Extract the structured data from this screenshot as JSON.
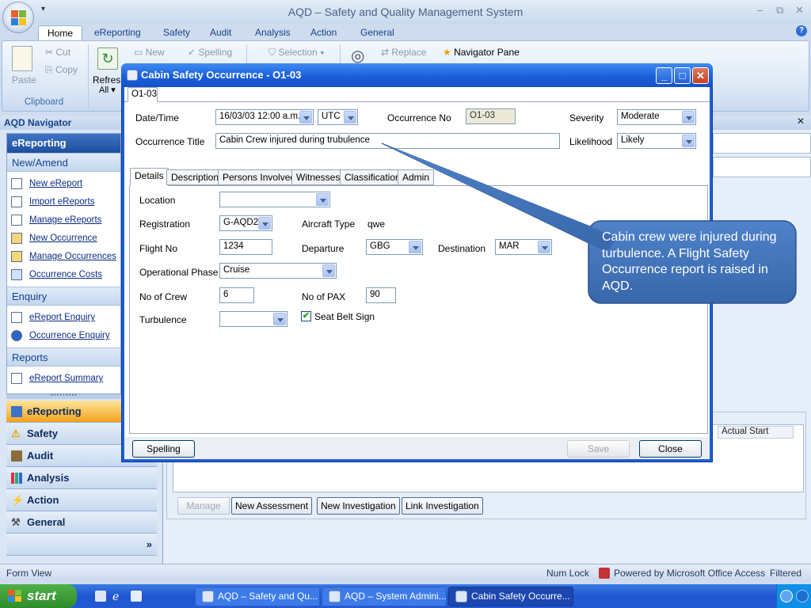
{
  "app": {
    "title": "AQD – Safety and Quality Management System",
    "minimize": "–",
    "restore": "⧉",
    "close": "✕",
    "help": "?",
    "qat_arrow": "▾"
  },
  "ribbon": {
    "tabs": [
      "Home",
      "eReporting",
      "Safety",
      "Audit",
      "Analysis",
      "Action",
      "General"
    ],
    "active_tab": "Home",
    "paste": "Paste",
    "cut": "Cut",
    "copy": "Copy",
    "clipboard_group": "Clipboard",
    "refresh": "Refresh",
    "refresh_all": "All ▾",
    "new": "New",
    "spelling": "Spelling",
    "selection": "Selection ▾",
    "replace": "Replace",
    "navigator_pane": "Navigator Pane"
  },
  "navigator": {
    "header": "AQD Navigator",
    "title": "eReporting",
    "section_new": "New/Amend",
    "items_new": [
      "New eReport",
      "Import eReports",
      "Manage eReports",
      "New Occurrence",
      "Manage Occurrences",
      "Occurrence Costs"
    ],
    "section_enquiry": "Enquiry",
    "items_enquiry": [
      "eReport Enquiry",
      "Occurrence Enquiry"
    ],
    "section_reports": "Reports",
    "items_reports": [
      "eReport Summary"
    ],
    "modules": [
      "eReporting",
      "Safety",
      "Audit",
      "Analysis",
      "Action",
      "General"
    ],
    "active_module": "eReporting",
    "more": "»"
  },
  "background": {
    "grid_column": "Actual Start",
    "close_x": "✕",
    "buttons": [
      "Manage",
      "New Assessment",
      "New Investigation",
      "Link Investigation"
    ]
  },
  "status_bar": {
    "left": "Form View",
    "num_lock": "Num Lock",
    "powered_by": "Powered by Microsoft Office Access",
    "filtered": "Filtered"
  },
  "taskbar": {
    "start": "start",
    "tasks": [
      "AQD – Safety and Qu...",
      "AQD – System Admini...",
      "Cabin Safety Occurre..."
    ],
    "active_task": 2
  },
  "dialog": {
    "title": "Cabin Safety Occurrence - O1-03",
    "tab": "O1-03",
    "date_time_label": "Date/Time",
    "date_time_value": "16/03/03 12:00 a.m.",
    "timezone_value": "UTC",
    "occurrence_no_label": "Occurrence No",
    "occurrence_no_value": "O1-03",
    "severity_label": "Severity",
    "severity_value": "Moderate",
    "occurrence_title_label": "Occurrence Title",
    "occurrence_title_value": "Cabin Crew injured during trubulence",
    "likelihood_label": "Likelihood",
    "likelihood_value": "Likely",
    "subtabs": [
      "Details",
      "Description",
      "Persons Involved",
      "Witnesses",
      "Classification",
      "Admin"
    ],
    "active_subtab": "Details",
    "details": {
      "location_label": "Location",
      "location_value": "",
      "registration_label": "Registration",
      "registration_value": "G-AQD2",
      "aircraft_type_label": "Aircraft Type",
      "aircraft_type_value": "qwe",
      "flight_no_label": "Flight No",
      "flight_no_value": "1234",
      "departure_label": "Departure",
      "departure_value": "GBG",
      "destination_label": "Destination",
      "destination_value": "MAR",
      "operational_phase_label": "Operational Phase",
      "operational_phase_value": "Cruise",
      "crew_label": "No of Crew",
      "crew_value": "6",
      "pax_label": "No of PAX",
      "pax_value": "90",
      "turbulence_label": "Turbulence",
      "turbulence_value": "",
      "seat_belt_label": "Seat Belt Sign",
      "seat_belt_checked": "✔"
    },
    "spelling_button": "Spelling",
    "save_button": "Save",
    "close_button": "Close"
  },
  "callout": {
    "text": "Cabin crew were injured during turbulence.  A Flight Safety Occurrence report is raised in AQD."
  },
  "colors": {
    "dialog_title": "#1a5fdb",
    "callout_fill": "#3a6eb5",
    "nav_active": "#f7a41d",
    "taskbar": "#2459d4",
    "start_green": "#2e8c2a"
  }
}
